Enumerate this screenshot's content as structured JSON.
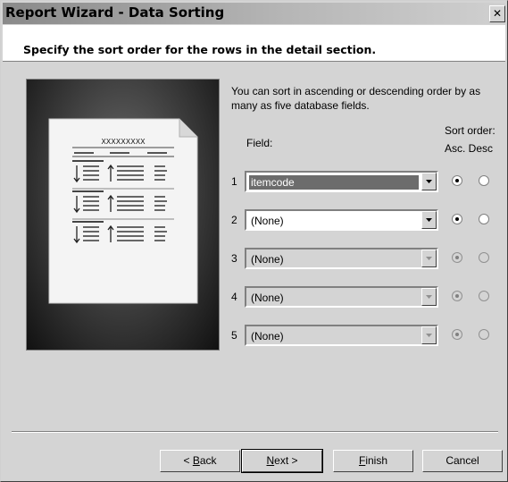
{
  "window": {
    "title": "Report Wizard - Data Sorting",
    "close_glyph": "✕"
  },
  "header": {
    "subtitle": "Specify the sort order for the rows in the detail section."
  },
  "illustration": {
    "icon": "report-document-icon",
    "doc_title": "XXXXXXXXX"
  },
  "description": "You can sort in ascending or descending order by as many as five database fields.",
  "columns": {
    "field": "Field:",
    "sort_order": "Sort order:",
    "asc_desc": "Asc. Desc"
  },
  "rows": [
    {
      "num": "1",
      "value": "itemcode",
      "enabled": true,
      "selected": true,
      "sort": "asc"
    },
    {
      "num": "2",
      "value": "(None)",
      "enabled": true,
      "selected": false,
      "sort": "asc"
    },
    {
      "num": "3",
      "value": "(None)",
      "enabled": false,
      "selected": false,
      "sort": "asc"
    },
    {
      "num": "4",
      "value": "(None)",
      "enabled": false,
      "selected": false,
      "sort": "asc"
    },
    {
      "num": "5",
      "value": "(None)",
      "enabled": false,
      "selected": false,
      "sort": "asc"
    }
  ],
  "buttons": {
    "back": {
      "pre": "< ",
      "key": "B",
      "post": "ack"
    },
    "next": {
      "pre": "",
      "key": "N",
      "post": "ext >"
    },
    "finish": {
      "pre": "",
      "key": "F",
      "post": "inish"
    },
    "cancel": {
      "label": "Cancel"
    }
  }
}
